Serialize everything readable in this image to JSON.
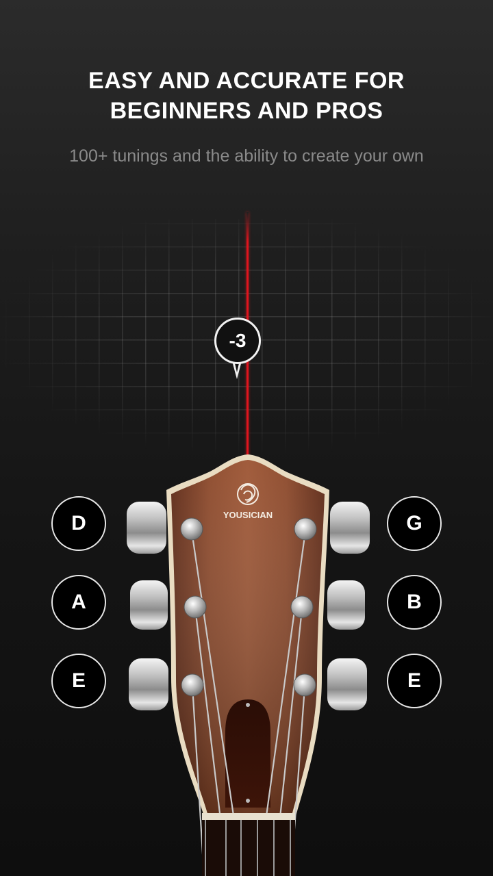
{
  "header": {
    "title_line1": "EASY AND ACCURATE FOR",
    "title_line2": "BEGINNERS AND PROS",
    "subtitle": "100+ tunings and the ability to create your own"
  },
  "tuner": {
    "cents_offset": "-3",
    "needle_color": "#e0141e"
  },
  "guitar": {
    "brand": "YOUSICIAN",
    "left_strings": [
      "D",
      "A",
      "E"
    ],
    "right_strings": [
      "G",
      "B",
      "E"
    ]
  }
}
